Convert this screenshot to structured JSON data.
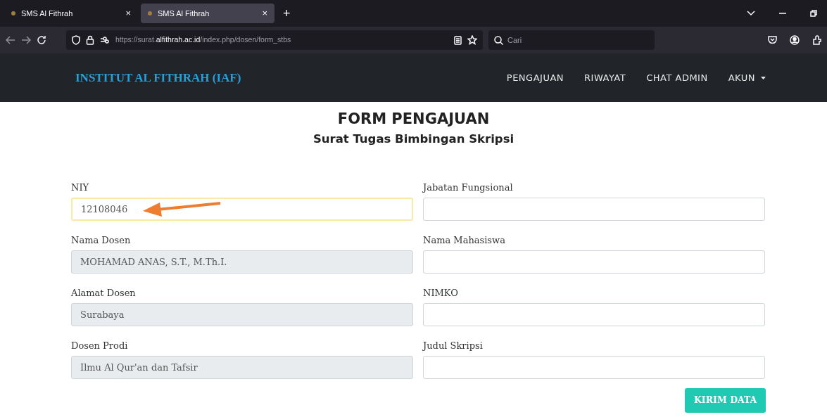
{
  "browser": {
    "tabs": [
      {
        "title": "SMS Al Fithrah",
        "close": "×",
        "selected": false
      },
      {
        "title": "SMS Al Fithrah",
        "close": "×",
        "selected": true
      }
    ],
    "new_tab": "+",
    "url": {
      "prefix": "https://surat.",
      "domain": "alfithrah.ac.id",
      "path": "/index.php/dosen/form_stbs"
    },
    "search": {
      "placeholder": "Cari"
    }
  },
  "navbar": {
    "brand": "INSTITUT AL FITHRAH (IAF)",
    "items": [
      {
        "label": "PENGAJUAN",
        "dropdown": false
      },
      {
        "label": "RIWAYAT",
        "dropdown": false
      },
      {
        "label": "CHAT ADMIN",
        "dropdown": false
      },
      {
        "label": "AKUN",
        "dropdown": true
      }
    ]
  },
  "form": {
    "title": "FORM PENGAJUAN",
    "subtitle": "Surat Tugas Bimbingan Skripsi",
    "left_fields": [
      {
        "label": "NIY",
        "value": "12108046",
        "readonly": false,
        "focused": true,
        "annotated": true
      },
      {
        "label": "Nama Dosen",
        "value": "MOHAMAD ANAS, S.T., M.Th.I.",
        "readonly": true,
        "focused": false,
        "annotated": false
      },
      {
        "label": "Alamat Dosen",
        "value": "Surabaya",
        "readonly": true,
        "focused": false,
        "annotated": false
      },
      {
        "label": "Dosen Prodi",
        "value": "Ilmu Al Qur'an dan Tafsir",
        "readonly": true,
        "focused": false,
        "annotated": false
      }
    ],
    "right_fields": [
      {
        "label": "Jabatan Fungsional",
        "readonly": false,
        "focused": false,
        "annotated": false
      },
      {
        "label": "Nama Mahasiswa",
        "readonly": false,
        "focused": false,
        "annotated": false
      },
      {
        "label": "NIMKO",
        "readonly": false,
        "focused": false,
        "annotated": false
      },
      {
        "label": "Judul Skripsi",
        "readonly": false,
        "focused": false,
        "annotated": false
      }
    ],
    "submit": "KIRIM DATA"
  }
}
